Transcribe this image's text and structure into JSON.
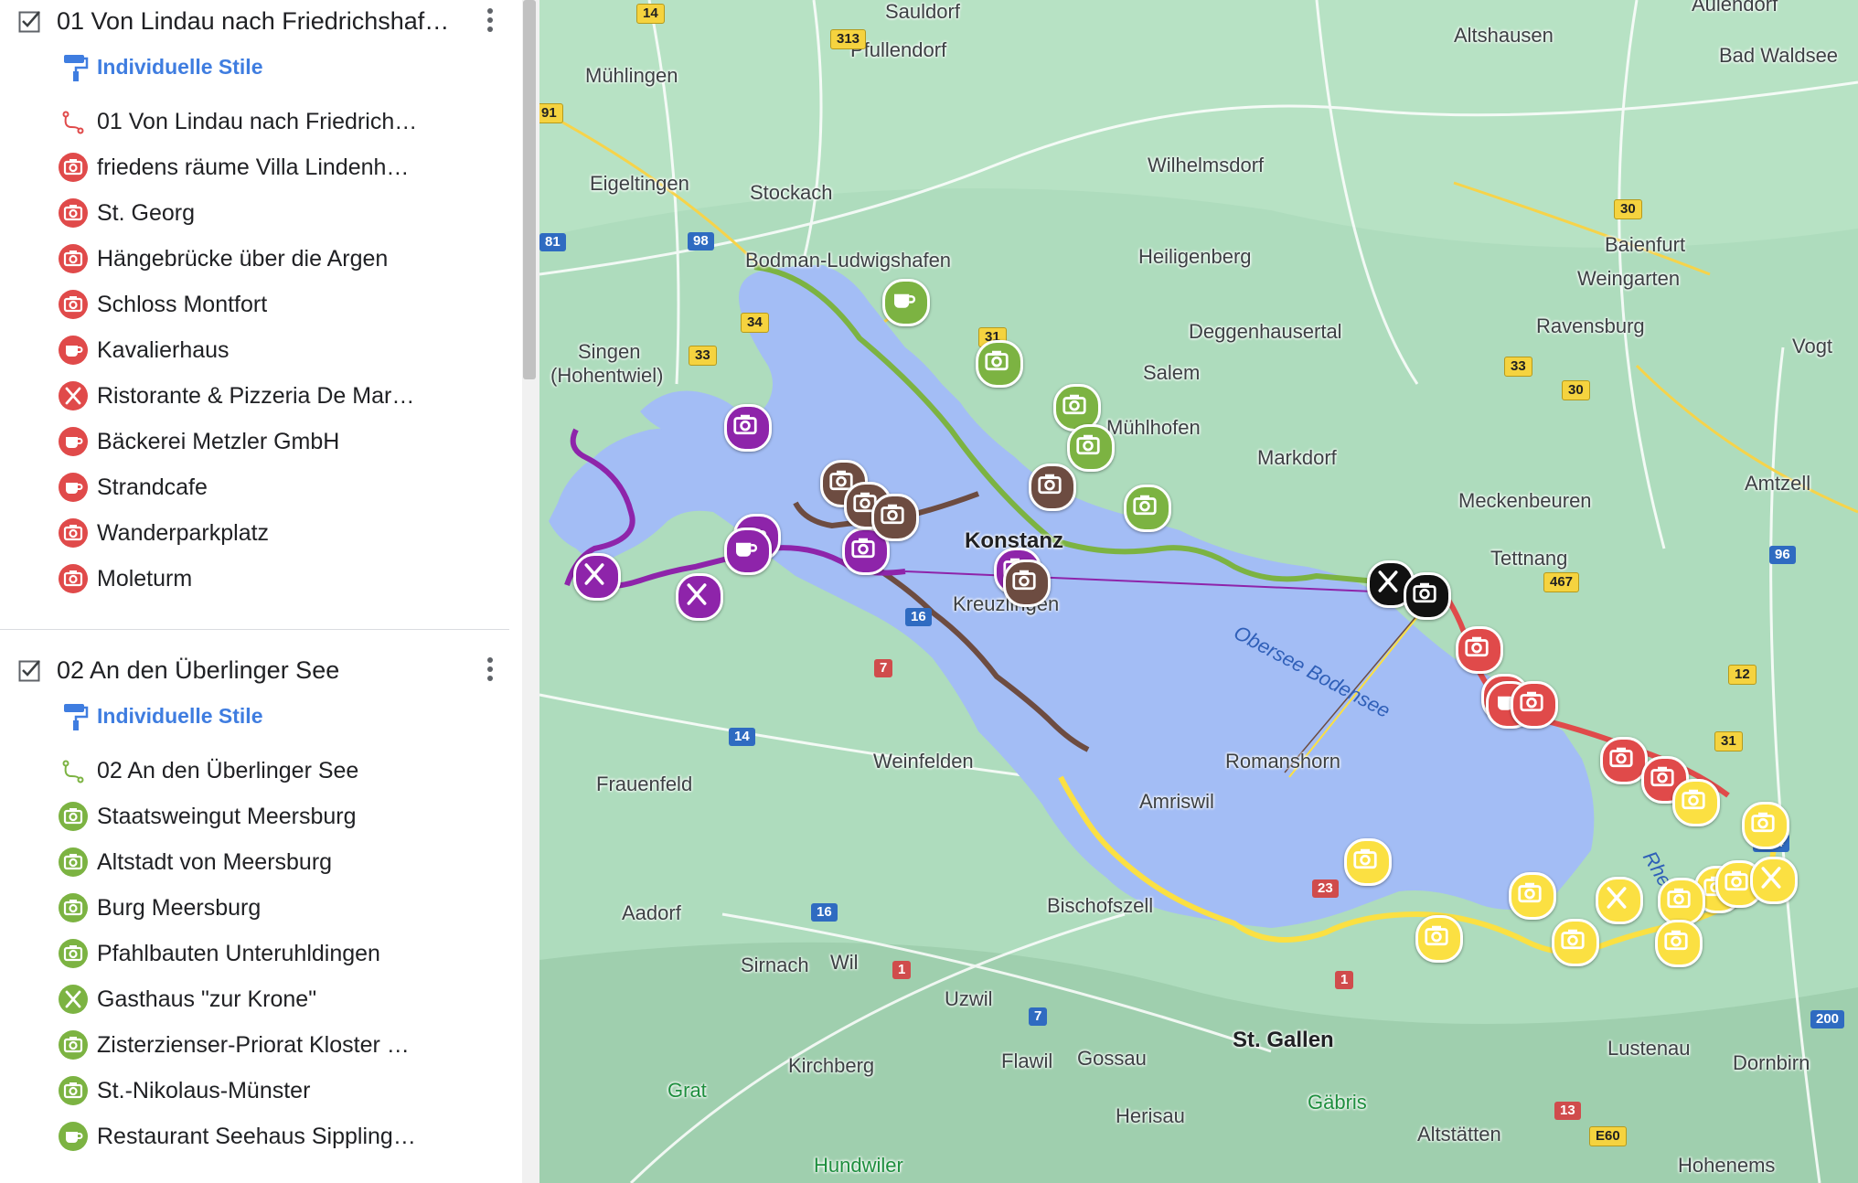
{
  "colors": {
    "red": "#e04a4a",
    "green": "#7cb342",
    "purple": "#8e24aa",
    "brown": "#6d4c41",
    "yellow": "#fbe042",
    "black": "#111111",
    "water": "#a3bdf5",
    "land": "#a8d8b9",
    "link": "#3f7de0"
  },
  "sidebar": {
    "layers": [
      {
        "title": "01 Von Lindau nach Friedrichshaf…",
        "checked": true,
        "style_label": "Individuelle Stile",
        "items": [
          {
            "label": "01 Von Lindau nach Friedrich…",
            "icon": "route-icon",
            "color": "#e04a4a"
          },
          {
            "label": "friedens räume Villa Lindenh…",
            "icon": "camera-icon",
            "color": "#e04a4a"
          },
          {
            "label": "St. Georg",
            "icon": "camera-icon",
            "color": "#e04a4a"
          },
          {
            "label": "Hängebrücke über die Argen",
            "icon": "camera-icon",
            "color": "#e04a4a"
          },
          {
            "label": "Schloss Montfort",
            "icon": "camera-icon",
            "color": "#e04a4a"
          },
          {
            "label": "Kavalierhaus",
            "icon": "cup-icon",
            "color": "#e04a4a"
          },
          {
            "label": "Ristorante & Pizzeria De Mar…",
            "icon": "cutlery-icon",
            "color": "#e04a4a"
          },
          {
            "label": "Bäckerei Metzler GmbH",
            "icon": "cup-icon",
            "color": "#e04a4a"
          },
          {
            "label": "Strandcafe",
            "icon": "cup-icon",
            "color": "#e04a4a"
          },
          {
            "label": "Wanderparkplatz",
            "icon": "camera-icon",
            "color": "#e04a4a"
          },
          {
            "label": "Moleturm",
            "icon": "camera-icon",
            "color": "#e04a4a"
          }
        ]
      },
      {
        "title": "02 An den Überlinger See",
        "checked": true,
        "style_label": "Individuelle Stile",
        "items": [
          {
            "label": "02 An den Überlinger See",
            "icon": "route-icon",
            "color": "#7cb342"
          },
          {
            "label": "Staatsweingut Meersburg",
            "icon": "camera-icon",
            "color": "#7cb342"
          },
          {
            "label": "Altstadt von Meersburg",
            "icon": "camera-icon",
            "color": "#7cb342"
          },
          {
            "label": "Burg Meersburg",
            "icon": "camera-icon",
            "color": "#7cb342"
          },
          {
            "label": "Pfahlbauten Unteruhldingen",
            "icon": "camera-icon",
            "color": "#7cb342"
          },
          {
            "label": "Gasthaus \"zur Krone\"",
            "icon": "cutlery-icon",
            "color": "#7cb342"
          },
          {
            "label": "Zisterzienser-Priorat Kloster …",
            "icon": "camera-icon",
            "color": "#7cb342"
          },
          {
            "label": "St.-Nikolaus-Münster",
            "icon": "camera-icon",
            "color": "#7cb342"
          },
          {
            "label": "Restaurant Seehaus Sippling…",
            "icon": "cup-icon",
            "color": "#7cb342"
          }
        ]
      }
    ]
  },
  "map": {
    "places": [
      {
        "name": "Sauldorf",
        "kind": "town"
      },
      {
        "name": "Aulendorf",
        "kind": "town"
      },
      {
        "name": "Pfullendorf",
        "kind": "town"
      },
      {
        "name": "Altshausen",
        "kind": "town"
      },
      {
        "name": "Bad Waldsee",
        "kind": "town"
      },
      {
        "name": "Mühlingen",
        "kind": "town"
      },
      {
        "name": "Wilhelmsdorf",
        "kind": "town"
      },
      {
        "name": "Eigeltingen",
        "kind": "town"
      },
      {
        "name": "Stockach",
        "kind": "town"
      },
      {
        "name": "Baienfurt",
        "kind": "town"
      },
      {
        "name": "Weingarten",
        "kind": "town"
      },
      {
        "name": "Heiligenberg",
        "kind": "town"
      },
      {
        "name": "Bodman-Ludwigshafen",
        "kind": "town"
      },
      {
        "name": "Deggenhausertal",
        "kind": "town"
      },
      {
        "name": "Ravensburg",
        "kind": "town"
      },
      {
        "name": "Vogt",
        "kind": "town"
      },
      {
        "name": "Singen",
        "kind": "town"
      },
      {
        "name": "(Hohentwiel)",
        "kind": "town"
      },
      {
        "name": "Salem",
        "kind": "town"
      },
      {
        "name": "Mühlhofen",
        "kind": "town"
      },
      {
        "name": "Markdorf",
        "kind": "town"
      },
      {
        "name": "Meckenbeuren",
        "kind": "town"
      },
      {
        "name": "Amtzell",
        "kind": "town"
      },
      {
        "name": "Tettnang",
        "kind": "town"
      },
      {
        "name": "Konstanz",
        "kind": "city"
      },
      {
        "name": "Kreuzlingen",
        "kind": "town"
      },
      {
        "name": "Weinfelden",
        "kind": "town"
      },
      {
        "name": "Frauenfeld",
        "kind": "town"
      },
      {
        "name": "Amriswil",
        "kind": "town"
      },
      {
        "name": "Romanshorn",
        "kind": "town"
      },
      {
        "name": "Aadorf",
        "kind": "town"
      },
      {
        "name": "Bischofszell",
        "kind": "town"
      },
      {
        "name": "Sirnach",
        "kind": "town"
      },
      {
        "name": "Wil",
        "kind": "town"
      },
      {
        "name": "Uzwil",
        "kind": "town"
      },
      {
        "name": "St. Gallen",
        "kind": "city"
      },
      {
        "name": "Kirchberg",
        "kind": "town"
      },
      {
        "name": "Flawil",
        "kind": "town"
      },
      {
        "name": "Gossau",
        "kind": "town"
      },
      {
        "name": "Lustenau",
        "kind": "town"
      },
      {
        "name": "Dornbirn",
        "kind": "town"
      },
      {
        "name": "Herisau",
        "kind": "town"
      },
      {
        "name": "Altstätten",
        "kind": "town"
      },
      {
        "name": "Hohenems",
        "kind": "town"
      },
      {
        "name": "Grat",
        "kind": "park"
      },
      {
        "name": "Gäbris",
        "kind": "park"
      },
      {
        "name": "Hundwiler",
        "kind": "park"
      },
      {
        "name": "Obersee Bodensee",
        "kind": "water"
      },
      {
        "name": "Rhein",
        "kind": "water"
      }
    ],
    "roads": [
      "14",
      "313",
      "31",
      "91",
      "81",
      "98",
      "34",
      "33",
      "30",
      "33",
      "30",
      "467",
      "96",
      "12",
      "31",
      "A14",
      "16",
      "7",
      "14",
      "16",
      "7",
      "1",
      "1",
      "23",
      "13",
      "200",
      "E60"
    ]
  }
}
